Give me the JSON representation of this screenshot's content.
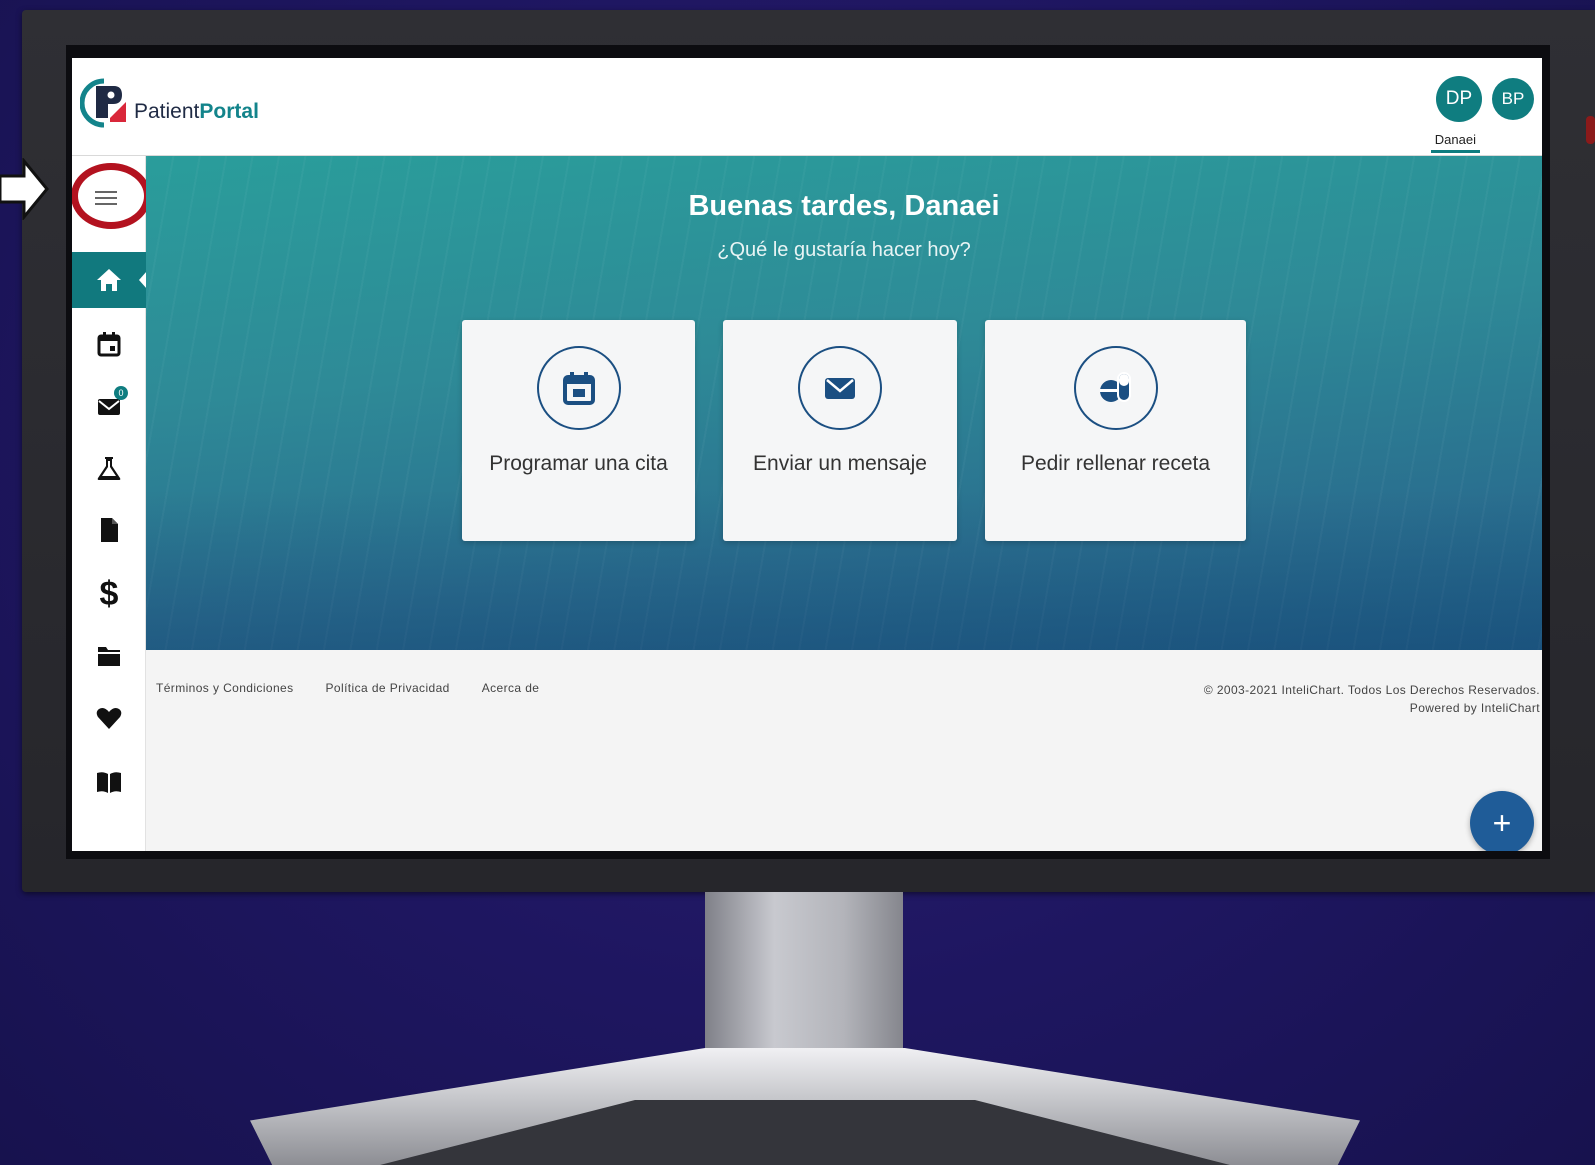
{
  "header": {
    "logo_text_part1": "Patient",
    "logo_text_part2": "Portal",
    "avatars": [
      {
        "initials": "DP"
      },
      {
        "initials": "BP"
      }
    ],
    "user_name": "Danaei"
  },
  "sidebar": {
    "items": [
      {
        "icon": "home-icon",
        "active": true
      },
      {
        "icon": "calendar-icon"
      },
      {
        "icon": "mail-icon",
        "badge": "0"
      },
      {
        "icon": "flask-icon"
      },
      {
        "icon": "document-icon"
      },
      {
        "icon": "dollar-icon",
        "glyph": "$"
      },
      {
        "icon": "folder-icon"
      },
      {
        "icon": "heart-icon"
      },
      {
        "icon": "book-icon"
      }
    ]
  },
  "hero": {
    "greeting": "Buenas tardes, Danaei",
    "subtitle": "¿Qué le gustaría hacer hoy?",
    "cards": [
      {
        "label": "Programar una cita",
        "icon": "calendar-icon"
      },
      {
        "label": "Enviar un mensaje",
        "icon": "envelope-icon"
      },
      {
        "label": "Pedir rellenar receta",
        "icon": "pills-icon"
      }
    ]
  },
  "footer": {
    "links": [
      "Términos y Condiciones",
      "Política de Privacidad",
      "Acerca de"
    ],
    "copyright": "© 2003-2021 InteliChart. Todos Los Derechos Reservados.",
    "powered_by": "Powered by InteliChart"
  },
  "fab": {
    "glyph": "+"
  },
  "colors": {
    "brand_teal": "#0f7d80",
    "accent_blue": "#1f5c98",
    "highlight_red": "#b3121f"
  }
}
